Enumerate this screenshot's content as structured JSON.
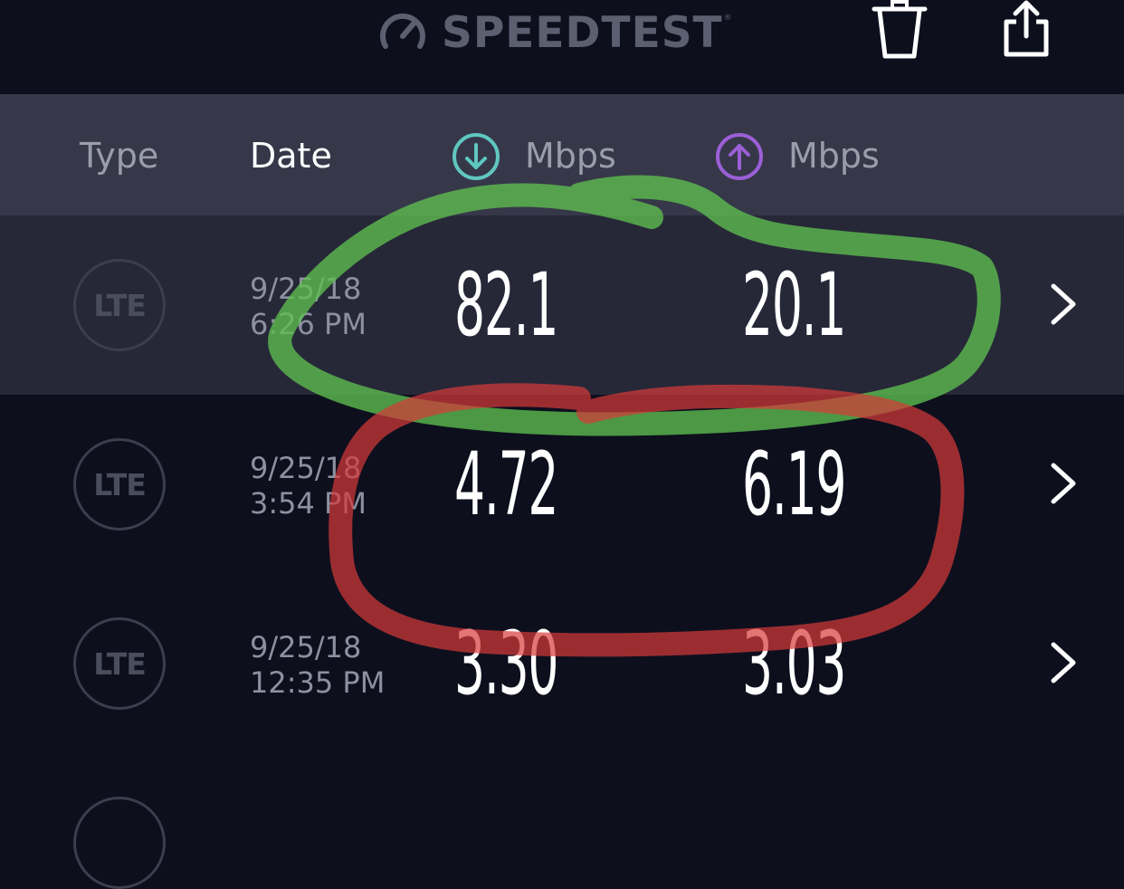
{
  "app": {
    "logo_text": "SPEEDTEST",
    "logo_mark": "®"
  },
  "toolbar": {
    "delete_icon": "trash-icon",
    "share_icon": "share-icon"
  },
  "table_header": {
    "type": "Type",
    "date": "Date",
    "download_unit": "Mbps",
    "upload_unit": "Mbps",
    "download_icon": "download-arrow-icon",
    "upload_icon": "upload-arrow-icon"
  },
  "results": [
    {
      "type": "LTE",
      "date": "9/25/18",
      "time": "6:26 PM",
      "download": "82.1",
      "upload": "20.1",
      "selected": true
    },
    {
      "type": "LTE",
      "date": "9/25/18",
      "time": "3:54 PM",
      "download": "4.72",
      "upload": "6.19",
      "selected": false
    },
    {
      "type": "LTE",
      "date": "9/25/18",
      "time": "12:35 PM",
      "download": "3.30",
      "upload": "3.03",
      "selected": false
    }
  ],
  "colors": {
    "background": "#0d0f1d",
    "header_bg": "#363849",
    "selected_row_bg": "#262838",
    "download_accent": "#5fc7c1",
    "upload_accent": "#9b5fd6",
    "annotation_green": "#5fbf4f",
    "annotation_red": "#d83a3a"
  }
}
